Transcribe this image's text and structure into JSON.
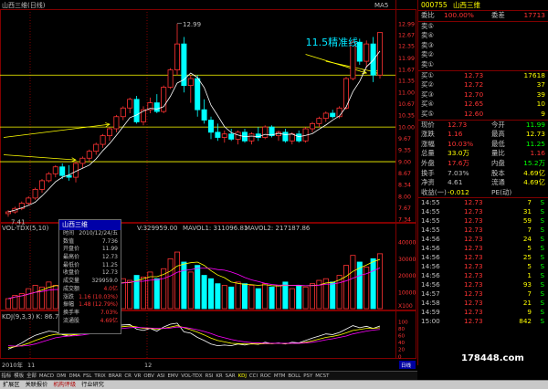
{
  "window": {
    "title": "山西三维(日线)",
    "top_label": "MA5"
  },
  "annotation": {
    "text": "11.5精准线",
    "color": "#00e5ff"
  },
  "colors": {
    "up": "#ff3333",
    "down": "#00ffff",
    "ma": "#ffffff",
    "yellow": "#ffff00",
    "pink": "#ff00ff",
    "green": "#00ff00",
    "bg": "#000000",
    "grid": "#800000"
  },
  "price_axis": {
    "ticks": [
      "12.99",
      "12.67",
      "12.35",
      "11.99",
      "11.67",
      "11.35",
      "11.00",
      "10.67",
      "10.35",
      "10.00",
      "9.67",
      "9.35",
      "9.00",
      "8.67",
      "8.34",
      "8.00",
      "7.67",
      "7.34"
    ]
  },
  "markers": {
    "high": "12.99",
    "low": "7.41"
  },
  "volume_panel": {
    "label": "VOL-TDX(5,10)",
    "legend": [
      {
        "text": "V:329959.00",
        "color": "#ffffff"
      },
      {
        "text": "MAVOL1: 311096.81",
        "color": "#ffff00"
      },
      {
        "text": "MAVOL2: 217187.86",
        "color": "#ff00ff"
      }
    ],
    "ticks": [
      "40000",
      "30000",
      "20000",
      "10000",
      "X100"
    ]
  },
  "kdj_panel": {
    "label": "KDJ(9,3,3) K: 86.7",
    "ticks": [
      "100",
      "80",
      "60",
      "40",
      "20",
      "0"
    ]
  },
  "date_axis": {
    "labels": [
      "2010年",
      "11",
      "12"
    ]
  },
  "chart_data": [
    {
      "type": "candlestick",
      "title": "",
      "ylim": [
        7.34,
        13.3
      ],
      "reference_lines": [
        11.5,
        10.0,
        9.0
      ],
      "candles": [
        {
          "o": 7.5,
          "h": 7.6,
          "l": 7.41,
          "c": 7.55
        },
        {
          "o": 7.55,
          "h": 7.7,
          "l": 7.5,
          "c": 7.65
        },
        {
          "o": 7.65,
          "h": 7.85,
          "l": 7.6,
          "c": 7.8
        },
        {
          "o": 7.8,
          "h": 8.0,
          "l": 7.75,
          "c": 7.95
        },
        {
          "o": 7.95,
          "h": 8.25,
          "l": 7.9,
          "c": 8.2
        },
        {
          "o": 8.2,
          "h": 8.5,
          "l": 8.1,
          "c": 8.45
        },
        {
          "o": 8.45,
          "h": 8.7,
          "l": 8.4,
          "c": 8.65
        },
        {
          "o": 8.65,
          "h": 8.9,
          "l": 8.55,
          "c": 8.85
        },
        {
          "o": 8.85,
          "h": 8.95,
          "l": 8.5,
          "c": 8.6
        },
        {
          "o": 8.6,
          "h": 8.9,
          "l": 8.45,
          "c": 8.55
        },
        {
          "o": 8.55,
          "h": 9.0,
          "l": 8.4,
          "c": 8.95
        },
        {
          "o": 8.95,
          "h": 9.15,
          "l": 8.8,
          "c": 9.1
        },
        {
          "o": 9.1,
          "h": 9.35,
          "l": 9.0,
          "c": 9.3
        },
        {
          "o": 9.3,
          "h": 9.55,
          "l": 9.2,
          "c": 9.5
        },
        {
          "o": 9.5,
          "h": 9.8,
          "l": 9.4,
          "c": 9.75
        },
        {
          "o": 9.75,
          "h": 10.0,
          "l": 9.6,
          "c": 9.95
        },
        {
          "o": 9.95,
          "h": 10.35,
          "l": 9.85,
          "c": 10.3
        },
        {
          "o": 10.3,
          "h": 10.6,
          "l": 10.2,
          "c": 10.55
        },
        {
          "o": 10.55,
          "h": 10.85,
          "l": 10.4,
          "c": 10.8
        },
        {
          "o": 10.8,
          "h": 10.9,
          "l": 10.1,
          "c": 10.15
        },
        {
          "o": 10.15,
          "h": 10.6,
          "l": 10.05,
          "c": 10.5
        },
        {
          "o": 10.5,
          "h": 10.85,
          "l": 10.4,
          "c": 10.7
        },
        {
          "o": 10.7,
          "h": 10.95,
          "l": 10.4,
          "c": 10.45
        },
        {
          "o": 10.45,
          "h": 11.2,
          "l": 10.4,
          "c": 11.15
        },
        {
          "o": 11.15,
          "h": 11.7,
          "l": 11.1,
          "c": 11.65
        },
        {
          "o": 11.65,
          "h": 12.99,
          "l": 11.5,
          "c": 12.4
        },
        {
          "o": 12.4,
          "h": 12.6,
          "l": 11.0,
          "c": 11.2
        },
        {
          "o": 11.2,
          "h": 11.5,
          "l": 10.7,
          "c": 11.4
        },
        {
          "o": 11.4,
          "h": 11.5,
          "l": 10.3,
          "c": 10.5
        },
        {
          "o": 10.5,
          "h": 10.8,
          "l": 10.1,
          "c": 10.2
        },
        {
          "o": 10.2,
          "h": 10.3,
          "l": 9.65,
          "c": 9.85
        },
        {
          "o": 9.85,
          "h": 10.1,
          "l": 9.6,
          "c": 9.7
        },
        {
          "o": 9.7,
          "h": 9.9,
          "l": 9.55,
          "c": 9.8
        },
        {
          "o": 9.8,
          "h": 9.95,
          "l": 9.6,
          "c": 9.65
        },
        {
          "o": 9.65,
          "h": 9.9,
          "l": 9.5,
          "c": 9.85
        },
        {
          "o": 9.85,
          "h": 9.95,
          "l": 9.55,
          "c": 9.6
        },
        {
          "o": 9.6,
          "h": 9.85,
          "l": 9.5,
          "c": 9.8
        },
        {
          "o": 9.8,
          "h": 10.0,
          "l": 9.6,
          "c": 9.7
        },
        {
          "o": 9.7,
          "h": 10.05,
          "l": 9.65,
          "c": 10.0
        },
        {
          "o": 10.0,
          "h": 10.05,
          "l": 9.7,
          "c": 9.75
        },
        {
          "o": 9.75,
          "h": 9.9,
          "l": 9.6,
          "c": 9.85
        },
        {
          "o": 9.85,
          "h": 9.95,
          "l": 9.55,
          "c": 9.6
        },
        {
          "o": 9.6,
          "h": 9.85,
          "l": 9.5,
          "c": 9.8
        },
        {
          "o": 9.8,
          "h": 9.9,
          "l": 9.55,
          "c": 9.6
        },
        {
          "o": 9.6,
          "h": 10.0,
          "l": 9.55,
          "c": 9.95
        },
        {
          "o": 9.95,
          "h": 10.15,
          "l": 9.85,
          "c": 10.1
        },
        {
          "o": 10.1,
          "h": 10.3,
          "l": 10.0,
          "c": 10.25
        },
        {
          "o": 10.25,
          "h": 10.45,
          "l": 10.15,
          "c": 10.4
        },
        {
          "o": 10.4,
          "h": 10.5,
          "l": 10.25,
          "c": 10.3
        },
        {
          "o": 10.3,
          "h": 10.6,
          "l": 10.25,
          "c": 10.55
        },
        {
          "o": 10.55,
          "h": 11.45,
          "l": 10.5,
          "c": 11.4
        },
        {
          "o": 11.4,
          "h": 12.5,
          "l": 11.35,
          "c": 12.45
        },
        {
          "o": 12.45,
          "h": 12.55,
          "l": 11.8,
          "c": 11.9
        },
        {
          "o": 11.9,
          "h": 12.5,
          "l": 11.7,
          "c": 12.4
        },
        {
          "o": 12.4,
          "h": 12.6,
          "l": 11.3,
          "c": 11.5
        },
        {
          "o": 11.5,
          "h": 12.73,
          "l": 11.4,
          "c": 12.73
        }
      ]
    },
    {
      "type": "bar",
      "title": "",
      "ylim": [
        0,
        45000
      ],
      "volumes": [
        6000,
        8000,
        9000,
        12000,
        14000,
        13000,
        16000,
        14000,
        12000,
        15000,
        18000,
        16000,
        15000,
        17000,
        14000,
        13000,
        16000,
        18000,
        17000,
        20000,
        19000,
        22000,
        18000,
        24000,
        30000,
        34000,
        28000,
        22000,
        26000,
        20000,
        18000,
        15000,
        14000,
        13000,
        16000,
        15000,
        14000,
        12000,
        15000,
        13000,
        14000,
        16000,
        12000,
        14000,
        13000,
        15000,
        17000,
        18000,
        16000,
        20000,
        26000,
        32000,
        28000,
        25000,
        30000,
        33000
      ]
    },
    {
      "type": "line",
      "title": "",
      "ylim": [
        0,
        100
      ],
      "series": [
        {
          "values": [
            20,
            28,
            38,
            50,
            60,
            66,
            72,
            70,
            62,
            58,
            64,
            72,
            78,
            82,
            84,
            86,
            88,
            90,
            91,
            78,
            74,
            80,
            72,
            84,
            92,
            95,
            70,
            66,
            54,
            45,
            35,
            30,
            32,
            30,
            35,
            32,
            36,
            34,
            40,
            36,
            38,
            35,
            40,
            38,
            45,
            52,
            58,
            64,
            62,
            68,
            78,
            88,
            82,
            86,
            80,
            86.7
          ]
        },
        {
          "values": [
            25,
            27,
            31,
            37,
            45,
            52,
            59,
            63,
            63,
            61,
            62,
            65,
            70,
            74,
            78,
            81,
            83,
            85,
            87,
            84,
            80,
            80,
            78,
            80,
            84,
            88,
            82,
            76,
            69,
            61,
            52,
            45,
            41,
            37,
            36,
            35,
            35,
            35,
            36,
            36,
            37,
            36,
            37,
            37,
            40,
            44,
            49,
            54,
            57,
            61,
            67,
            74,
            77,
            80,
            80,
            82
          ]
        },
        {
          "values": [
            30,
            29,
            29,
            31,
            35,
            41,
            47,
            53,
            56,
            58,
            59,
            61,
            64,
            67,
            71,
            74,
            77,
            80,
            82,
            83,
            82,
            81,
            80,
            80,
            81,
            84,
            83,
            80,
            76,
            71,
            65,
            58,
            53,
            48,
            44,
            41,
            39,
            38,
            37,
            37,
            37,
            37,
            37,
            37,
            38,
            40,
            43,
            47,
            50,
            54,
            58,
            64,
            68,
            72,
            75,
            77
          ]
        }
      ]
    }
  ],
  "info_box": {
    "title": "山西三维",
    "rows": [
      {
        "label": "时间",
        "value": "2010/12/24/五"
      },
      {
        "label": "数值",
        "value": "7.736"
      },
      {
        "label": "开盘价",
        "value": "11.99"
      },
      {
        "label": "最高价",
        "value": "12.73"
      },
      {
        "label": "最低价",
        "value": "11.25"
      },
      {
        "label": "收盘价",
        "value": "12.73"
      },
      {
        "label": "成交量",
        "value": "329959.0"
      },
      {
        "label": "成交额",
        "value": "4.0亿"
      },
      {
        "label": "涨跌",
        "value": "1.16 (10.03%)"
      },
      {
        "label": "振幅",
        "value": "1.48 (12.79%)"
      },
      {
        "label": "换手率",
        "value": "7.03%"
      },
      {
        "label": "流通股",
        "value": "4.69亿"
      }
    ]
  },
  "quote": {
    "code": "000755",
    "name": "山西三维",
    "weibi": {
      "label": "委比",
      "value": "100.00%",
      "label2": "委差",
      "value2": "17713"
    },
    "sell": [
      {
        "label": "卖⑤",
        "price": "",
        "vol": ""
      },
      {
        "label": "卖④",
        "price": "",
        "vol": ""
      },
      {
        "label": "卖③",
        "price": "",
        "vol": ""
      },
      {
        "label": "卖②",
        "price": "",
        "vol": ""
      },
      {
        "label": "卖①",
        "price": "",
        "vol": ""
      }
    ],
    "buy": [
      {
        "label": "买①",
        "price": "12.73",
        "vol": "17618"
      },
      {
        "label": "买②",
        "price": "12.72",
        "vol": "37"
      },
      {
        "label": "买③",
        "price": "12.70",
        "vol": "39"
      },
      {
        "label": "买④",
        "price": "12.65",
        "vol": "10"
      },
      {
        "label": "买⑤",
        "price": "12.60",
        "vol": "9"
      }
    ],
    "stats": [
      {
        "l1": "现价",
        "v1": "12.73",
        "l2": "今开",
        "v2": "11.99"
      },
      {
        "l1": "涨跌",
        "v1": "1.16",
        "l2": "最高",
        "v2": "12.73"
      },
      {
        "l1": "涨幅",
        "v1": "10.03%",
        "l2": "最低",
        "v2": "11.25"
      },
      {
        "l1": "总量",
        "v1": "33.0万",
        "l2": "量比",
        "v2": "1.16"
      },
      {
        "l1": "外盘",
        "v1": "17.6万",
        "l2": "内盘",
        "v2": "15.2万"
      },
      {
        "l1": "换手",
        "v1": "7.03%",
        "l2": "股本",
        "v2": "4.69亿"
      },
      {
        "l1": "净资",
        "v1": "4.61",
        "l2": "流通",
        "v2": "4.69亿"
      },
      {
        "l1": "收益(一)",
        "v1": "-0.012",
        "l2": "PE(动)",
        "v2": ""
      }
    ],
    "trades": [
      {
        "time": "14:55",
        "price": "12.73",
        "vol": "7",
        "side": "S"
      },
      {
        "time": "14:55",
        "price": "12.73",
        "vol": "31",
        "side": "S"
      },
      {
        "time": "14:55",
        "price": "12.73",
        "vol": "59",
        "side": "S"
      },
      {
        "time": "14:55",
        "price": "12.73",
        "vol": "7",
        "side": "S"
      },
      {
        "time": "14:56",
        "price": "12.73",
        "vol": "24",
        "side": "S"
      },
      {
        "time": "14:56",
        "price": "12.73",
        "vol": "5",
        "side": "S"
      },
      {
        "time": "14:56",
        "price": "12.73",
        "vol": "25",
        "side": "S"
      },
      {
        "time": "14:56",
        "price": "12.73",
        "vol": "5",
        "side": "S"
      },
      {
        "time": "14:56",
        "price": "12.73",
        "vol": "1",
        "side": "S"
      },
      {
        "time": "14:56",
        "price": "12.73",
        "vol": "93",
        "side": "S"
      },
      {
        "time": "14:57",
        "price": "12.73",
        "vol": "7",
        "side": "S"
      },
      {
        "time": "14:58",
        "price": "12.73",
        "vol": "21",
        "side": "S"
      },
      {
        "time": "14:59",
        "price": "12.73",
        "vol": "9",
        "side": "S"
      },
      {
        "time": "15:00",
        "price": "12.73",
        "vol": "842",
        "side": "S"
      }
    ]
  },
  "tabs": [
    "指标",
    "模板",
    "全部",
    "MACD",
    "DMI",
    "DMA",
    "FSL",
    "TRIX",
    "BRAR",
    "CR",
    "VR",
    "OBV",
    "ASI",
    "EMV",
    "VOL-TDX",
    "RSI",
    "KR",
    "SAR",
    "KDJ",
    "CCI",
    "ROC",
    "MTM",
    "BOLL",
    "PSY",
    "MCST"
  ],
  "active_tab": "KDJ",
  "statusbar": [
    {
      "text": "扩展区",
      "red": false
    },
    {
      "text": "关联报价",
      "red": false
    },
    {
      "text": "机构评级",
      "red": true
    },
    {
      "text": "行业研究",
      "red": false
    }
  ],
  "watermark": "178448.com",
  "period_label": "日线"
}
